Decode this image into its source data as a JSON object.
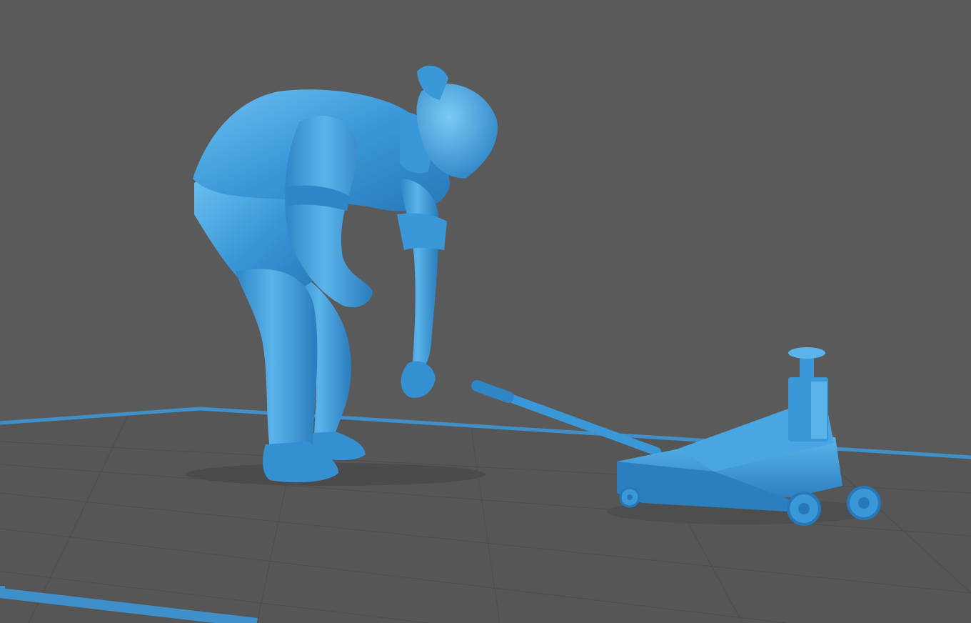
{
  "viewport": {
    "background_color": "#5a5a5a",
    "floor_color": "#565656",
    "grid_line_color": "#4c4c4c",
    "build_plate_border_color": "#3f8fc9",
    "model_color": "#3a98d8",
    "model_highlight_color": "#79c4f0",
    "model_shadow_color": "#1f6fab"
  },
  "scene": {
    "objects": [
      {
        "name": "mechanic-figure",
        "description_icon": "person-figure"
      },
      {
        "name": "floor-jack",
        "description_icon": "floor-jack"
      }
    ]
  }
}
